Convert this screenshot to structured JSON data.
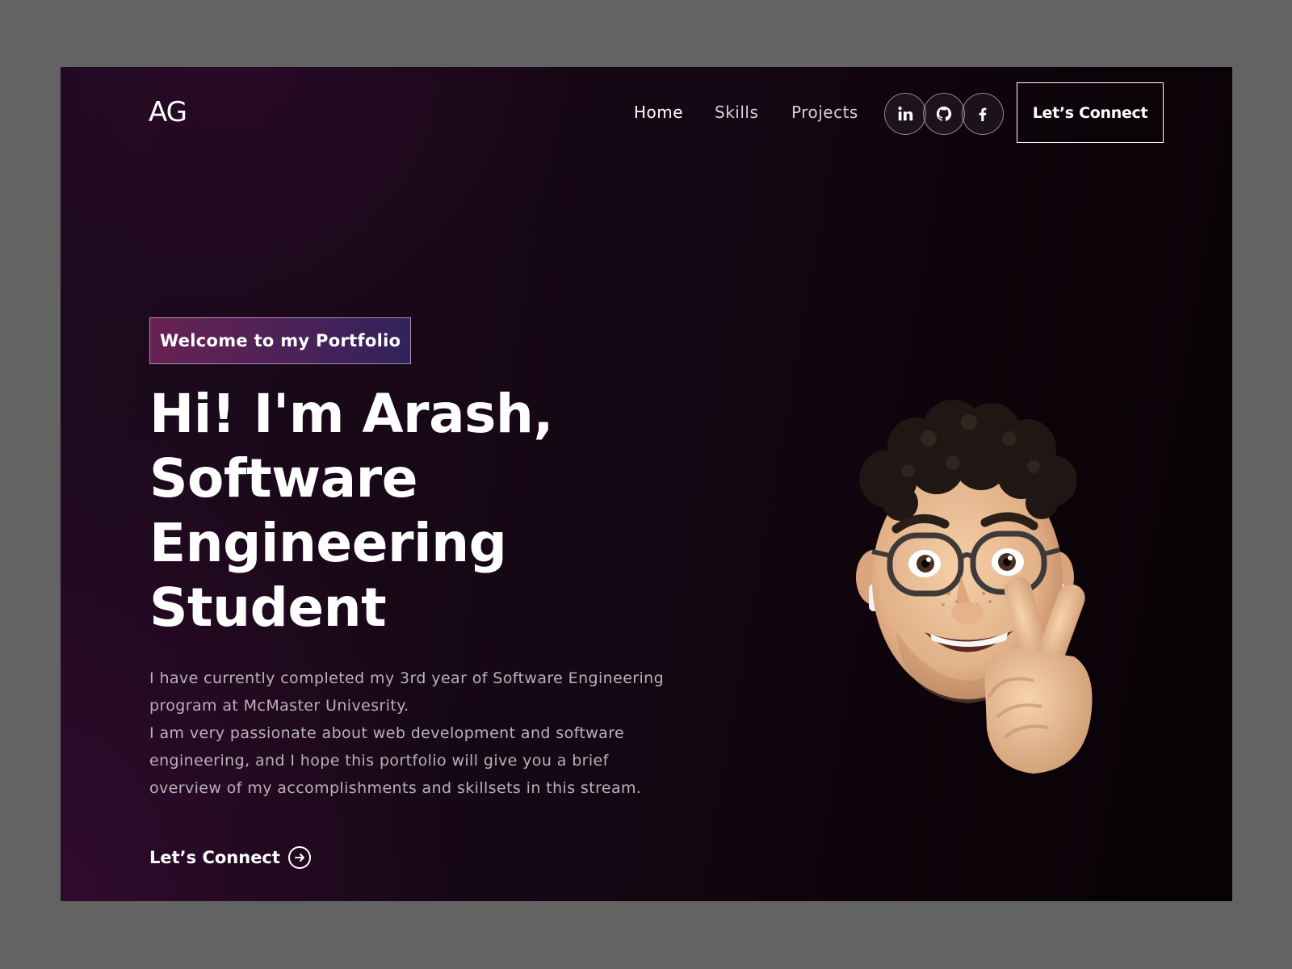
{
  "logo": "AG",
  "nav": {
    "links": [
      "Home",
      "Skills",
      "Projects"
    ],
    "social": [
      {
        "icon": "linkedin-icon",
        "label": "in"
      },
      {
        "icon": "github-icon"
      },
      {
        "icon": "facebook-icon",
        "label": "f"
      }
    ],
    "cta": "Let’s Connect"
  },
  "hero": {
    "tagline": "Welcome to my Portfolio",
    "headline": [
      "Hi! I'm Arash,",
      "Software",
      "Engineering",
      "Student"
    ],
    "bio": [
      "I have currently completed my 3rd year of Software Engineering program at McMaster Univesrity.",
      "I am very passionate about web development and software engineering, and I hope this portfolio will give you a brief overview of my accomplishments and skillsets in this stream."
    ],
    "cta": "Let’s Connect",
    "cta_icon": "arrow-right-circle-icon",
    "image": "memoji-avatar"
  },
  "colors": {
    "page_frame": "#636363",
    "background_dark": "#0c0309",
    "background_purple": "#1d0a1f",
    "tag_gradient_start": "#aa367c",
    "tag_gradient_end": "#4a2fbd",
    "text_primary": "#ffffff",
    "text_muted": "#b9b1b8"
  }
}
